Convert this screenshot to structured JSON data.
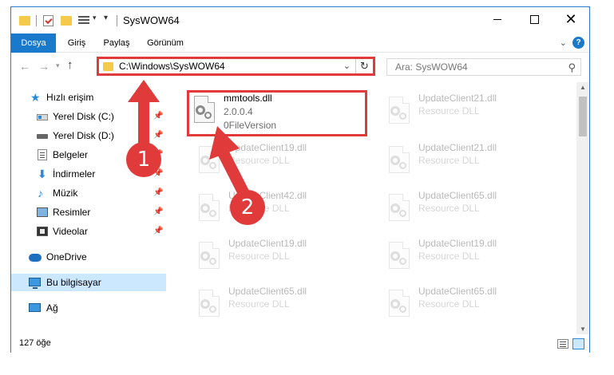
{
  "window": {
    "title": "SysWOW64",
    "minimize_label": "",
    "maximize_label": "",
    "close_label": "✕"
  },
  "ribbon": {
    "tabs": [
      {
        "label": "Dosya"
      },
      {
        "label": "Giriş"
      },
      {
        "label": "Paylaş"
      },
      {
        "label": "Görünüm"
      }
    ],
    "help_label": "?"
  },
  "nav": {
    "address": "C:\\Windows\\SysWOW64",
    "search_placeholder": "Ara: SysWOW64"
  },
  "sidebar": {
    "items": [
      {
        "label": "Hızlı erişim",
        "icon": "star-icon"
      },
      {
        "label": "Yerel Disk (C:)",
        "icon": "drive-icon",
        "pinned": true
      },
      {
        "label": "Yerel Disk (D:)",
        "icon": "drive-icon",
        "pinned": true
      },
      {
        "label": "Belgeler",
        "icon": "documents-icon",
        "pinned": true
      },
      {
        "label": "İndirmeler",
        "icon": "download-icon",
        "pinned": true
      },
      {
        "label": "Müzik",
        "icon": "music-icon",
        "pinned": true
      },
      {
        "label": "Resimler",
        "icon": "pictures-icon",
        "pinned": true
      },
      {
        "label": "Videolar",
        "icon": "videos-icon",
        "pinned": true
      },
      {
        "label": "OneDrive",
        "icon": "onedrive-icon"
      },
      {
        "label": "Bu bilgisayar",
        "icon": "computer-icon",
        "selected": true
      },
      {
        "label": "Ağ",
        "icon": "network-icon"
      }
    ]
  },
  "files": {
    "highlighted": {
      "name": "mmtools.dll",
      "line2": "2.0.0.4",
      "line3": "0FileVersion"
    },
    "items": [
      {
        "name": "UpdateClient21.dll",
        "type": "Resource DLL"
      },
      {
        "name": "UpdateClient19.dll",
        "type": "Resource DLL"
      },
      {
        "name": "UpdateClient21.dll",
        "type": "Resource DLL"
      },
      {
        "name": "UpdateClient42.dll",
        "type": "Resource DLL"
      },
      {
        "name": "UpdateClient65.dll",
        "type": "Resource DLL"
      },
      {
        "name": "UpdateClient19.dll",
        "type": "Resource DLL"
      },
      {
        "name": "UpdateClient19.dll",
        "type": "Resource DLL"
      },
      {
        "name": "UpdateClient65.dll",
        "type": "Resource DLL"
      },
      {
        "name": "UpdateClient65.dll",
        "type": "Resource DLL"
      }
    ]
  },
  "status": {
    "item_count": "127 öğe"
  },
  "annotations": {
    "badge1": "1",
    "badge2": "2",
    "color": "#e03a3a"
  },
  "colors": {
    "accent": "#1979ca",
    "selected_bg": "#cce8ff",
    "highlight_red": "#e03a3a"
  }
}
